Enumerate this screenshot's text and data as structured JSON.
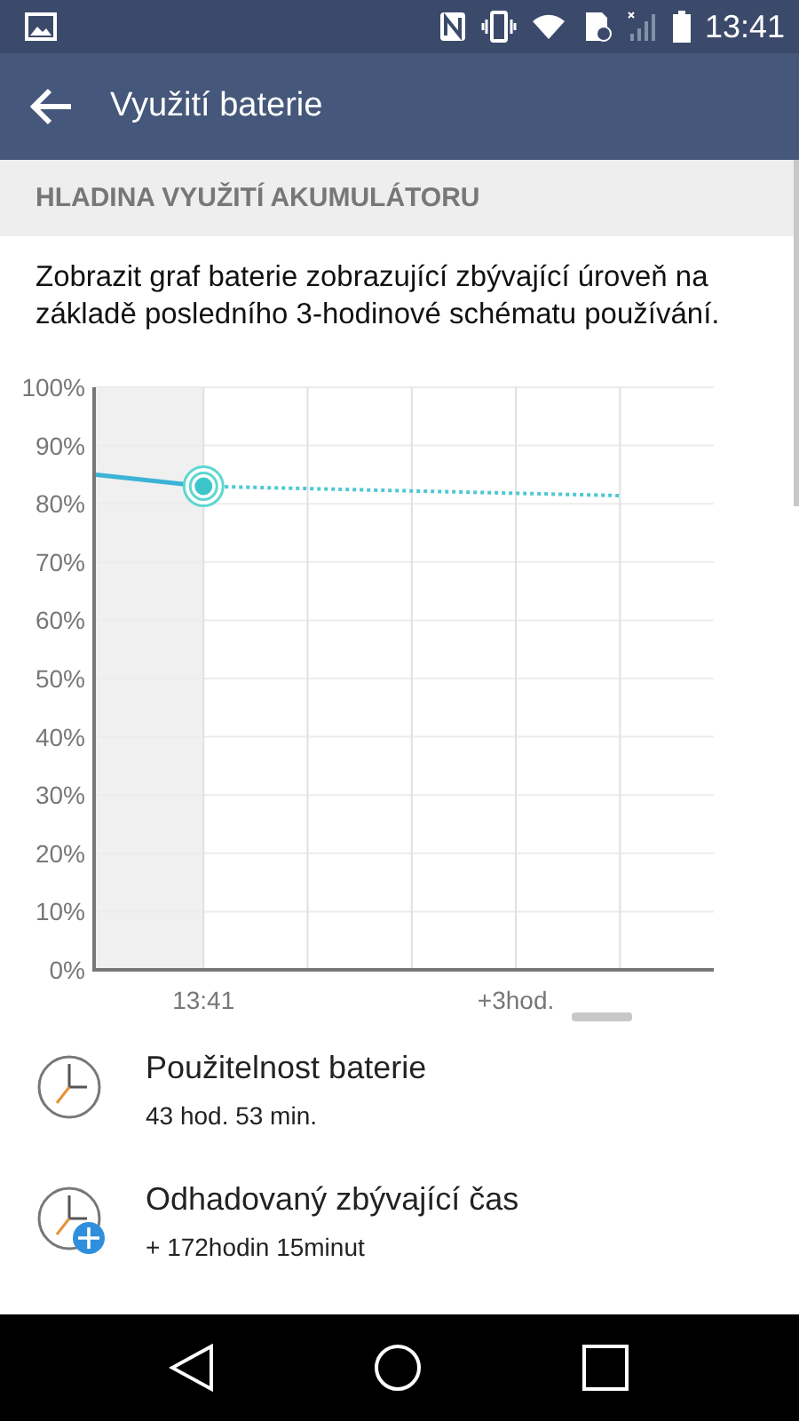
{
  "status_bar": {
    "time": "13:41"
  },
  "app_bar": {
    "title": "Využití baterie"
  },
  "section": {
    "title": "HLADINA VYUŽITÍ AKUMULÁTORU"
  },
  "description": "Zobrazit graf baterie zobrazující zbývající úroveň na základě posledního 3-hodinové schématu používání.",
  "chart": {
    "chart_data": {
      "type": "line",
      "categories": [
        null,
        "13:41",
        null,
        null,
        "+3hod.",
        null
      ],
      "series": [
        {
          "color": "#3bb3d6",
          "line_style": "solid",
          "values": [
            85,
            83,
            null,
            null,
            null,
            null
          ]
        },
        {
          "color": "#4ec7d6",
          "line_style": "dotted",
          "values": [
            null,
            83,
            82.6,
            82.2,
            81.8,
            81.4
          ]
        }
      ],
      "grid": true,
      "ylim": [
        0,
        100
      ],
      "yticks": [
        {
          "value": 0,
          "label": "0%"
        },
        {
          "value": 10,
          "label": "10%"
        },
        {
          "value": 20,
          "label": "20%"
        },
        {
          "value": 30,
          "label": "30%"
        },
        {
          "value": 40,
          "label": "40%"
        },
        {
          "value": 50,
          "label": "50%"
        },
        {
          "value": 60,
          "label": "60%"
        },
        {
          "value": 70,
          "label": "70%"
        },
        {
          "value": 80,
          "label": "80%"
        },
        {
          "value": 90,
          "label": "90%"
        },
        {
          "value": 100,
          "label": "100%"
        }
      ]
    }
  },
  "items": [
    {
      "kind": "clock",
      "title": "Použitelnost baterie",
      "value": "43 hod. 53 min."
    },
    {
      "kind": "clock_plus",
      "title": "Odhadovaný zbývající čas",
      "value": "+ 172hodin 15minut"
    }
  ]
}
